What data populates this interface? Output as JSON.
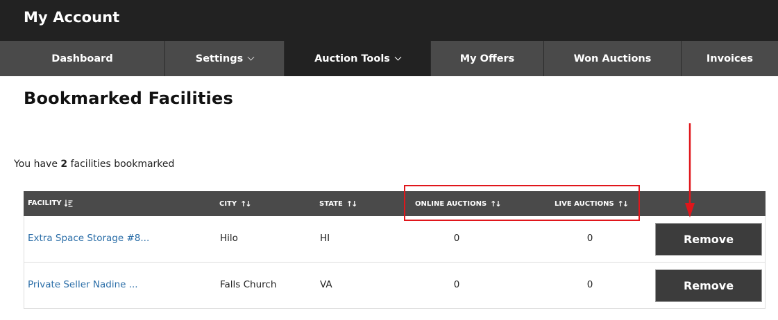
{
  "header": {
    "title": "My Account"
  },
  "nav": {
    "items": [
      {
        "label": "Dashboard",
        "dropdown": false,
        "active": false
      },
      {
        "label": "Settings",
        "dropdown": true,
        "active": false
      },
      {
        "label": "Auction Tools",
        "dropdown": true,
        "active": true
      },
      {
        "label": "My Offers",
        "dropdown": false,
        "active": false
      },
      {
        "label": "Won Auctions",
        "dropdown": false,
        "active": false
      },
      {
        "label": "Invoices",
        "dropdown": false,
        "active": false
      }
    ]
  },
  "page": {
    "title": "Bookmarked Facilities",
    "summary_prefix": "You have",
    "summary_count": "2",
    "summary_suffix": "facilities bookmarked"
  },
  "table": {
    "headers": {
      "facility": "FACILITY",
      "city": "CITY",
      "state": "STATE",
      "online": "ONLINE AUCTIONS",
      "live": "LIVE AUCTIONS"
    },
    "rows": [
      {
        "facility": "Extra Space Storage #8...",
        "city": "Hilo",
        "state": "HI",
        "online": "0",
        "live": "0",
        "action": "Remove"
      },
      {
        "facility": "Private Seller Nadine ...",
        "city": "Falls Church",
        "state": "VA",
        "online": "0",
        "live": "0",
        "action": "Remove"
      }
    ]
  },
  "colors": {
    "topbar": "#222222",
    "nav": "#4a4a4a",
    "nav_active": "#222222",
    "link": "#2b6ea8",
    "button": "#3c3c3c",
    "annotation": "#e0161b"
  }
}
